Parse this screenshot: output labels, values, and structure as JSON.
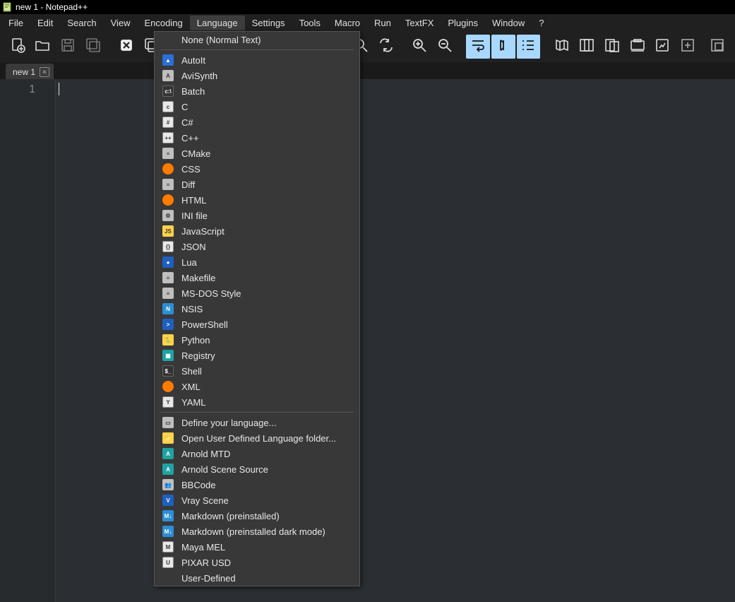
{
  "title": "new 1 - Notepad++",
  "menubar": [
    "File",
    "Edit",
    "Search",
    "View",
    "Encoding",
    "Language",
    "Settings",
    "Tools",
    "Macro",
    "Run",
    "TextFX",
    "Plugins",
    "Window",
    "?"
  ],
  "active_menu_index": 5,
  "toolbar_icons": [
    "new-file",
    "open-file",
    "save",
    "save-all",
    "close",
    "close-all",
    "print",
    "cut",
    "copy",
    "paste",
    "undo",
    "redo",
    "find",
    "replace",
    "zoom-in",
    "zoom-out",
    "wrap",
    "show-all",
    "indent-guide",
    "doc-map",
    "doc-list",
    "func-list",
    "folder-workspace",
    "monitor",
    "spacer",
    "plus-box",
    "minus-box"
  ],
  "active_toolbar": [
    "wrap",
    "show-all",
    "indent-guide"
  ],
  "tab": {
    "label": "new 1"
  },
  "gutter": {
    "line1": "1"
  },
  "dropdown": {
    "top_item": "None (Normal Text)",
    "groups": [
      [
        {
          "label": "AutoIt",
          "icon": "ic-blue",
          "glyph": "▲"
        },
        {
          "label": "AviSynth",
          "icon": "ic-grey",
          "glyph": "A"
        },
        {
          "label": "Batch",
          "icon": "ic-dark",
          "glyph": "c:\\"
        },
        {
          "label": "C",
          "icon": "ic-white",
          "glyph": "c"
        },
        {
          "label": "C#",
          "icon": "ic-white",
          "glyph": "#"
        },
        {
          "label": "C++",
          "icon": "ic-white",
          "glyph": "++"
        },
        {
          "label": "CMake",
          "icon": "ic-grey",
          "glyph": "≡"
        },
        {
          "label": "CSS",
          "icon": "ic-orange",
          "glyph": ""
        },
        {
          "label": "Diff",
          "icon": "ic-grey",
          "glyph": "≡"
        },
        {
          "label": "HTML",
          "icon": "ic-orange",
          "glyph": ""
        },
        {
          "label": "INI file",
          "icon": "ic-grey",
          "glyph": "⚙"
        },
        {
          "label": "JavaScript",
          "icon": "ic-yellow",
          "glyph": "JS"
        },
        {
          "label": "JSON",
          "icon": "ic-white",
          "glyph": "{}"
        },
        {
          "label": "Lua",
          "icon": "ic-bluep",
          "glyph": "●"
        },
        {
          "label": "Makefile",
          "icon": "ic-grey",
          "glyph": "≡"
        },
        {
          "label": "MS-DOS Style",
          "icon": "ic-grey",
          "glyph": "≡"
        },
        {
          "label": "NSIS",
          "icon": "ic-cyanbox",
          "glyph": "N"
        },
        {
          "label": "PowerShell",
          "icon": "ic-bluep",
          "glyph": ">"
        },
        {
          "label": "Python",
          "icon": "ic-yellow",
          "glyph": "🐍"
        },
        {
          "label": "Registry",
          "icon": "ic-teal",
          "glyph": "▦"
        },
        {
          "label": "Shell",
          "icon": "ic-dark",
          "glyph": "$_"
        },
        {
          "label": "XML",
          "icon": "ic-orange",
          "glyph": ""
        },
        {
          "label": "YAML",
          "icon": "ic-white",
          "glyph": "Y"
        }
      ],
      [
        {
          "label": "Define your language...",
          "icon": "ic-grey",
          "glyph": "▭"
        },
        {
          "label": "Open User Defined Language folder...",
          "icon": "ic-yellow",
          "glyph": "📁"
        },
        {
          "label": "Arnold MTD",
          "icon": "ic-teal",
          "glyph": "A"
        },
        {
          "label": "Arnold Scene Source",
          "icon": "ic-teal",
          "glyph": "A"
        },
        {
          "label": "BBCode",
          "icon": "ic-grey",
          "glyph": "👥"
        },
        {
          "label": "Vray Scene",
          "icon": "ic-bluep",
          "glyph": "V"
        },
        {
          "label": "Markdown (preinstalled)",
          "icon": "ic-cyanbox",
          "glyph": "M↓"
        },
        {
          "label": "Markdown (preinstalled dark mode)",
          "icon": "ic-cyanbox",
          "glyph": "M↓"
        },
        {
          "label": "Maya MEL",
          "icon": "ic-white",
          "glyph": "M"
        },
        {
          "label": "PIXAR USD",
          "icon": "ic-white",
          "glyph": "U"
        },
        {
          "label": "User-Defined",
          "icon": "ic-none",
          "glyph": ""
        }
      ]
    ]
  }
}
